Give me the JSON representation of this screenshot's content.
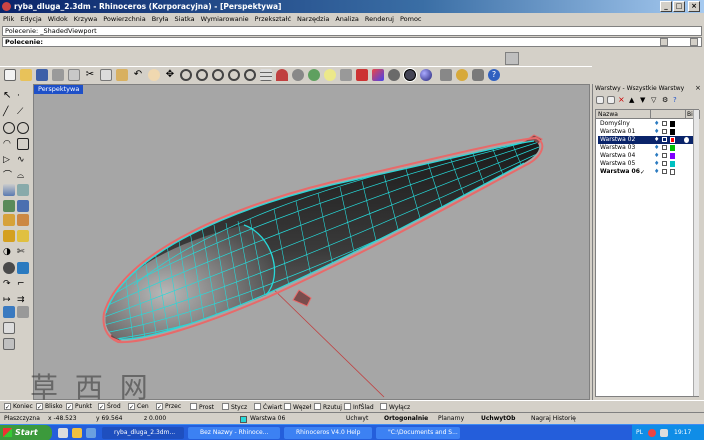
{
  "window": {
    "title": "ryba_dluga_2.3dm - Rhinoceros (Korporacyjna) - [Perspektywa]"
  },
  "menu": [
    "Plik",
    "Edycja",
    "Widok",
    "Krzywa",
    "Powierzchnia",
    "Bryła",
    "Siatka",
    "Wymiarowanie",
    "Przekształć",
    "Narzędzia",
    "Analiza",
    "Renderuj",
    "Pomoc"
  ],
  "command": {
    "history": "Polecenie: _ShadedViewport",
    "prompt": "Polecenie:"
  },
  "viewport": {
    "tab": "Perspektywa"
  },
  "layers_panel": {
    "title": "Warstwy - Wszystkie Warstwy",
    "col_name": "Nazwa",
    "col_material": "Bibl",
    "rows": [
      {
        "name": "Domyślny",
        "color": "#000000"
      },
      {
        "name": "Warstwa 01",
        "color": "#000000"
      },
      {
        "name": "Warstwa 02",
        "color": "#ff0000",
        "selected": true
      },
      {
        "name": "Warstwa 03",
        "color": "#00c000"
      },
      {
        "name": "Warstwa 04",
        "color": "#8000ff"
      },
      {
        "name": "Warstwa 05",
        "color": "#00c0c0"
      },
      {
        "name": "Warstwa 06",
        "color": "#ffffff",
        "current": "✓"
      }
    ]
  },
  "osnap": [
    "Koniec",
    "Blisko",
    "Punkt",
    "Środ",
    "Cen",
    "Przec",
    "Prost",
    "Stycz",
    "Ćwiart",
    "Węzeł",
    "Rzutuj",
    "InfŚlad",
    "Wyłącz"
  ],
  "osnap_checked": [
    true,
    true,
    true,
    true,
    true,
    true,
    false,
    false,
    false,
    false,
    false,
    false,
    false
  ],
  "status": {
    "cplane": "Płaszczyzna",
    "x": "x -48.523",
    "y": "y 69.564",
    "z": "z 0.000",
    "layer": "Warstwa 06",
    "snap": "Uchwyt",
    "ortho": "Ortogonalnie",
    "planar": "Planarny",
    "osnap": "UchwytOb",
    "history": "Nagraj Historię"
  },
  "taskbar": {
    "start": "Start",
    "tasks": [
      "ryba_dluga_2.3dm...",
      "Bez Nazwy - Rhinoce...",
      "Rhinoceros V4.0 Help",
      "\"C:\\Documents and S..."
    ],
    "lang": "PL",
    "clock": "19:17"
  },
  "watermark": "草 西 网",
  "colors": {
    "mesh": "#27d9d9",
    "highlight": "#e86a6a",
    "viewport_bg": "#a6a6a6"
  }
}
